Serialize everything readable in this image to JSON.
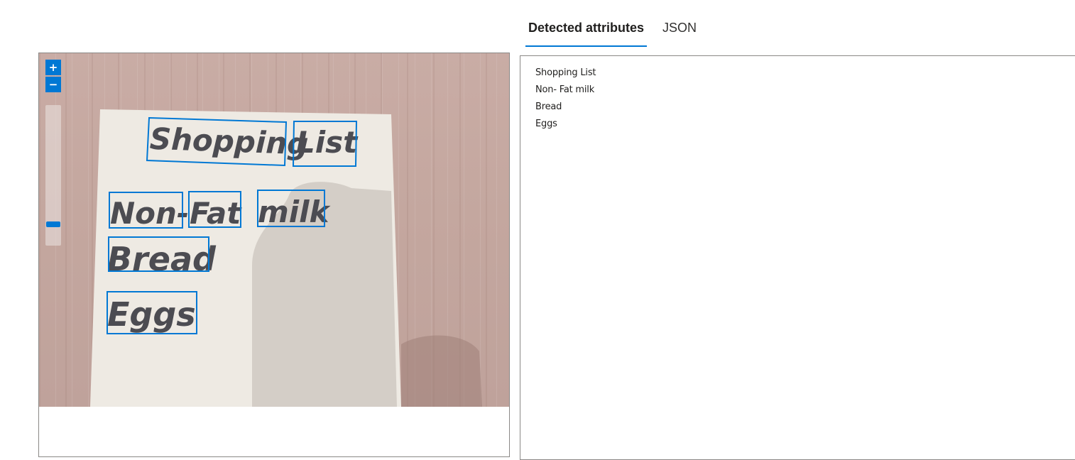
{
  "tabs": [
    {
      "label": "Detected attributes",
      "active": true
    },
    {
      "label": "JSON",
      "active": false
    }
  ],
  "viewer": {
    "zoom_in_label": "+",
    "zoom_out_label": "−",
    "zoom_level": 0.1,
    "note_words": [
      "Shopping",
      "List",
      "Non-",
      "Fat",
      "milk",
      "Bread",
      "Eggs"
    ],
    "box_color": "#0078d4"
  },
  "results": {
    "lines": [
      "Shopping List",
      "Non- Fat milk",
      "Bread",
      "Eggs"
    ]
  },
  "colors": {
    "accent": "#0078d4"
  }
}
